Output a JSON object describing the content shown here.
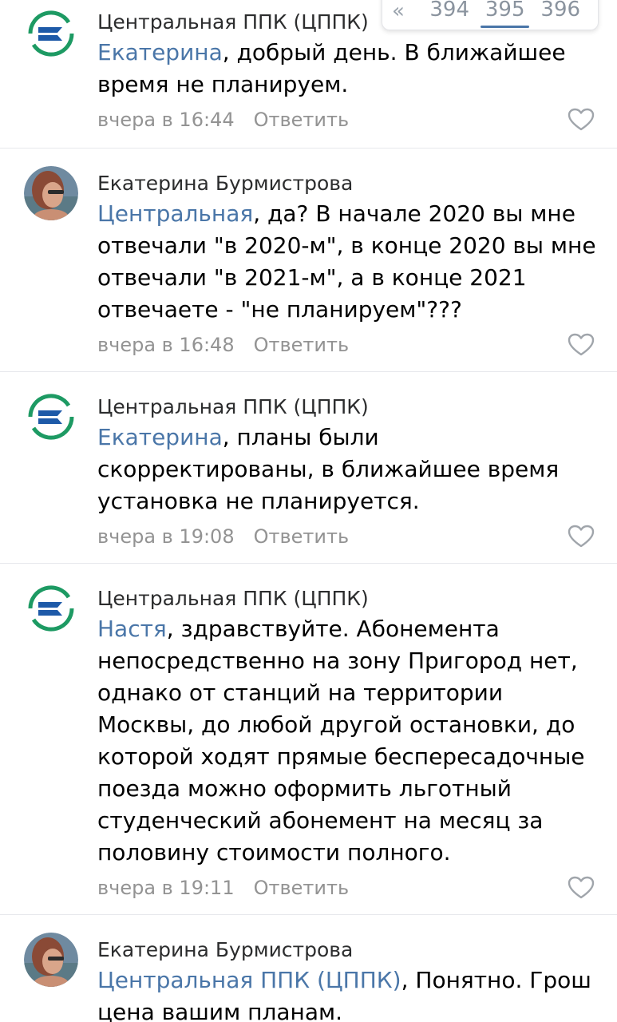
{
  "pager": {
    "arrow": "«",
    "pages": [
      "394",
      "395",
      "396"
    ],
    "active": "395"
  },
  "comments": [
    {
      "author": "Центральная ППК (ЦППК)",
      "avatar": "cppk-logo-icon",
      "mention": "Екатерина",
      "text": ", добрый день. В ближайшее время не планируем.",
      "time": "вчера в 16:44",
      "reply": "Ответить"
    },
    {
      "author": "Екатерина Бурмистрова",
      "avatar": "user-photo",
      "mention": "Центральная",
      "text": ", да? В начале 2020 вы мне отвечали \"в 2020-м\", в конце 2020 вы мне отвечали \"в 2021-м\", а в конце 2021 отвечаете - \"не планируем\"???",
      "time": "вчера в 16:48",
      "reply": "Ответить"
    },
    {
      "author": "Центральная ППК (ЦППК)",
      "avatar": "cppk-logo-icon",
      "mention": "Екатерина",
      "text": ", планы были скорректированы, в ближайшее время установка не планируется.",
      "time": "вчера в 19:08",
      "reply": "Ответить"
    },
    {
      "author": "Центральная ППК (ЦППК)",
      "avatar": "cppk-logo-icon",
      "mention": "Настя",
      "text": ", здравствуйте. Абонемента непосредственно на зону Пригород нет, однако от станций на территории Москвы, до любой другой остановки, до которой ходят прямые беспересадочные поезда можно оформить льготный студенческий абонемент на месяц за половину стоимости полного.",
      "time": "вчера в 19:11",
      "reply": "Ответить"
    },
    {
      "author": "Екатерина Бурмистрова",
      "avatar": "user-photo",
      "mention": "Центральная ППК (ЦППК)",
      "text": ", Понятно. Грош цена вашим планам.",
      "time": "",
      "reply": ""
    }
  ],
  "colors": {
    "link": "#4a76a8",
    "meta": "#939393",
    "logo_blue": "#1e5aa8",
    "logo_green": "#1d9a63"
  }
}
